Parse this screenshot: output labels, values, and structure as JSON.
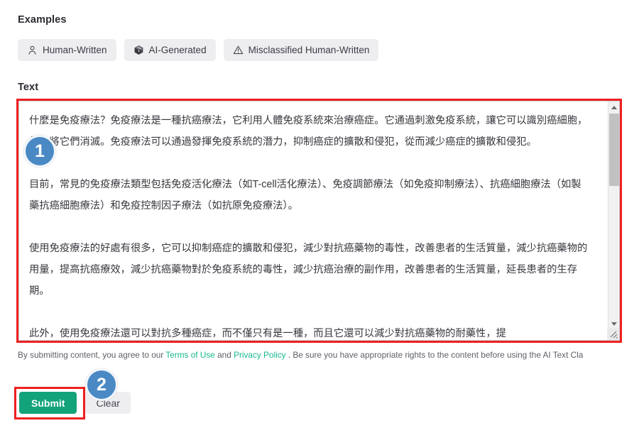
{
  "examples": {
    "label": "Examples",
    "items": [
      {
        "label": "Human-Written",
        "icon": "person-icon"
      },
      {
        "label": "AI-Generated",
        "icon": "cube-icon"
      },
      {
        "label": "Misclassified Human-Written",
        "icon": "warning-triangle-icon"
      }
    ]
  },
  "text_field": {
    "label": "Text",
    "value": "什麼是免疫療法？免疫療法是一種抗癌療法，它利用人體免疫系統來治療癌症。它通過刺激免疫系統，讓它可以識別癌細胞，然後將它們消滅。免疫療法可以通過發揮免疫系統的潛力，抑制癌症的擴散和侵犯，從而減少癌症的擴散和侵犯。\n\n目前，常見的免疫療法類型包括免疫活化療法（如T-cell活化療法）、免疫調節療法（如免疫抑制療法）、抗癌細胞療法（如製藥抗癌細胞療法）和免疫控制因子療法（如抗原免疫療法）。\n\n使用免疫療法的好處有很多，它可以抑制癌症的擴散和侵犯，減少對抗癌藥物的毒性，改善患者的生活質量，減少抗癌藥物的用量，提高抗癌療效，減少抗癌藥物對於免疫系統的毒性，減少抗癌治療的副作用，改善患者的生活質量，延長患者的生存期。\n\n此外，使用免疫療法還可以對抗多種癌症，而不僅只有是一種，而且它還可以減少對抗癌藥物的耐藥性，提",
    "placeholder": "",
    "scrollbar": {
      "up_arrow": "scroll-up-icon",
      "down_arrow": "scroll-down-icon",
      "resize_handle": "resize-handle-icon"
    }
  },
  "disclaimer": {
    "part1": "By submitting content, you agree to our ",
    "terms_link": "Terms of Use",
    "part2": " and ",
    "privacy_link": "Privacy Policy",
    "part3": ". Be sure you have appropriate rights to the content before using the AI Text Cla"
  },
  "actions": {
    "submit_label": "Submit",
    "clear_label": "Clear"
  },
  "annotations": {
    "badge_1": "1",
    "badge_2": "2"
  },
  "colors": {
    "accent_green": "#13a37b",
    "link_green": "#17b890",
    "highlight_red": "#ee2020",
    "badge_blue": "#4a89c4",
    "chip_bg": "#eeeef1"
  }
}
